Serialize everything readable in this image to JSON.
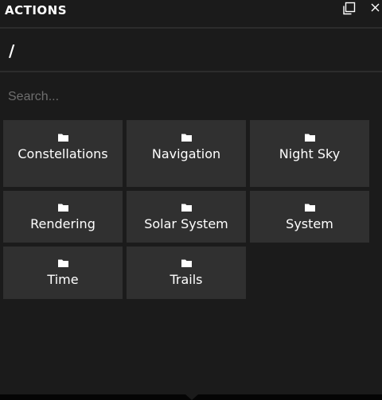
{
  "panel": {
    "title": "ACTIONS",
    "detach_icon": "detach-window-icon",
    "close_icon": "close-icon"
  },
  "path": "/",
  "search": {
    "placeholder": "Search...",
    "value": ""
  },
  "folder_icon": "folder-icon",
  "tiles": [
    {
      "label": "Constellations"
    },
    {
      "label": "Navigation"
    },
    {
      "label": "Night Sky"
    },
    {
      "label": "Rendering"
    },
    {
      "label": "Solar System"
    },
    {
      "label": "System"
    },
    {
      "label": "Time"
    },
    {
      "label": "Trails"
    }
  ],
  "colors": {
    "background": "#1b1b1b",
    "tile": "#303030",
    "divider": "#2c2c2c",
    "placeholder": "#6e6e6e"
  }
}
